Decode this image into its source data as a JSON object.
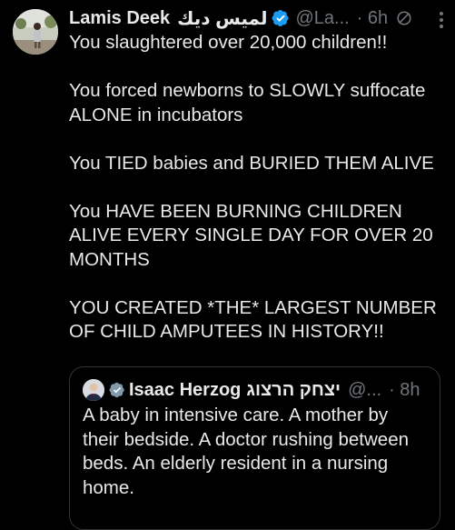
{
  "tweet": {
    "author_name": "Lamis Deek",
    "author_name_arabic": "لميس ديك",
    "handle": "@La...",
    "time": "· 6h",
    "paragraphs": [
      "You slaughtered over 20,000 children!!",
      "You forced newborns to SLOWLY suffocate ALONE in incubators",
      "You TIED babies and BURIED THEM ALIVE",
      "You HAVE BEEN BURNING CHILDREN ALIVE EVERY SINGLE DAY FOR OVER 20 MONTHS",
      "YOU CREATED *THE* LARGEST NUMBER OF CHILD AMPUTEES IN HISTORY!!"
    ]
  },
  "quoted_tweet": {
    "author_name": "Isaac Herzog",
    "author_name_hebrew": "יצחק הרצוג",
    "handle": "@...",
    "time": "· 8h",
    "text": "A baby in intensive care. A mother by their bedside. A doctor rushing between beds. An elderly resident in a nursing home."
  },
  "icons": {
    "verified": "verified-badge-icon",
    "mute": "mute-icon",
    "more": "more-options-icon"
  },
  "colors": {
    "background": "#000000",
    "text": "#e7e9ea",
    "secondary": "#71767b",
    "verified": "#1d9bf0",
    "border": "#2f3336"
  }
}
